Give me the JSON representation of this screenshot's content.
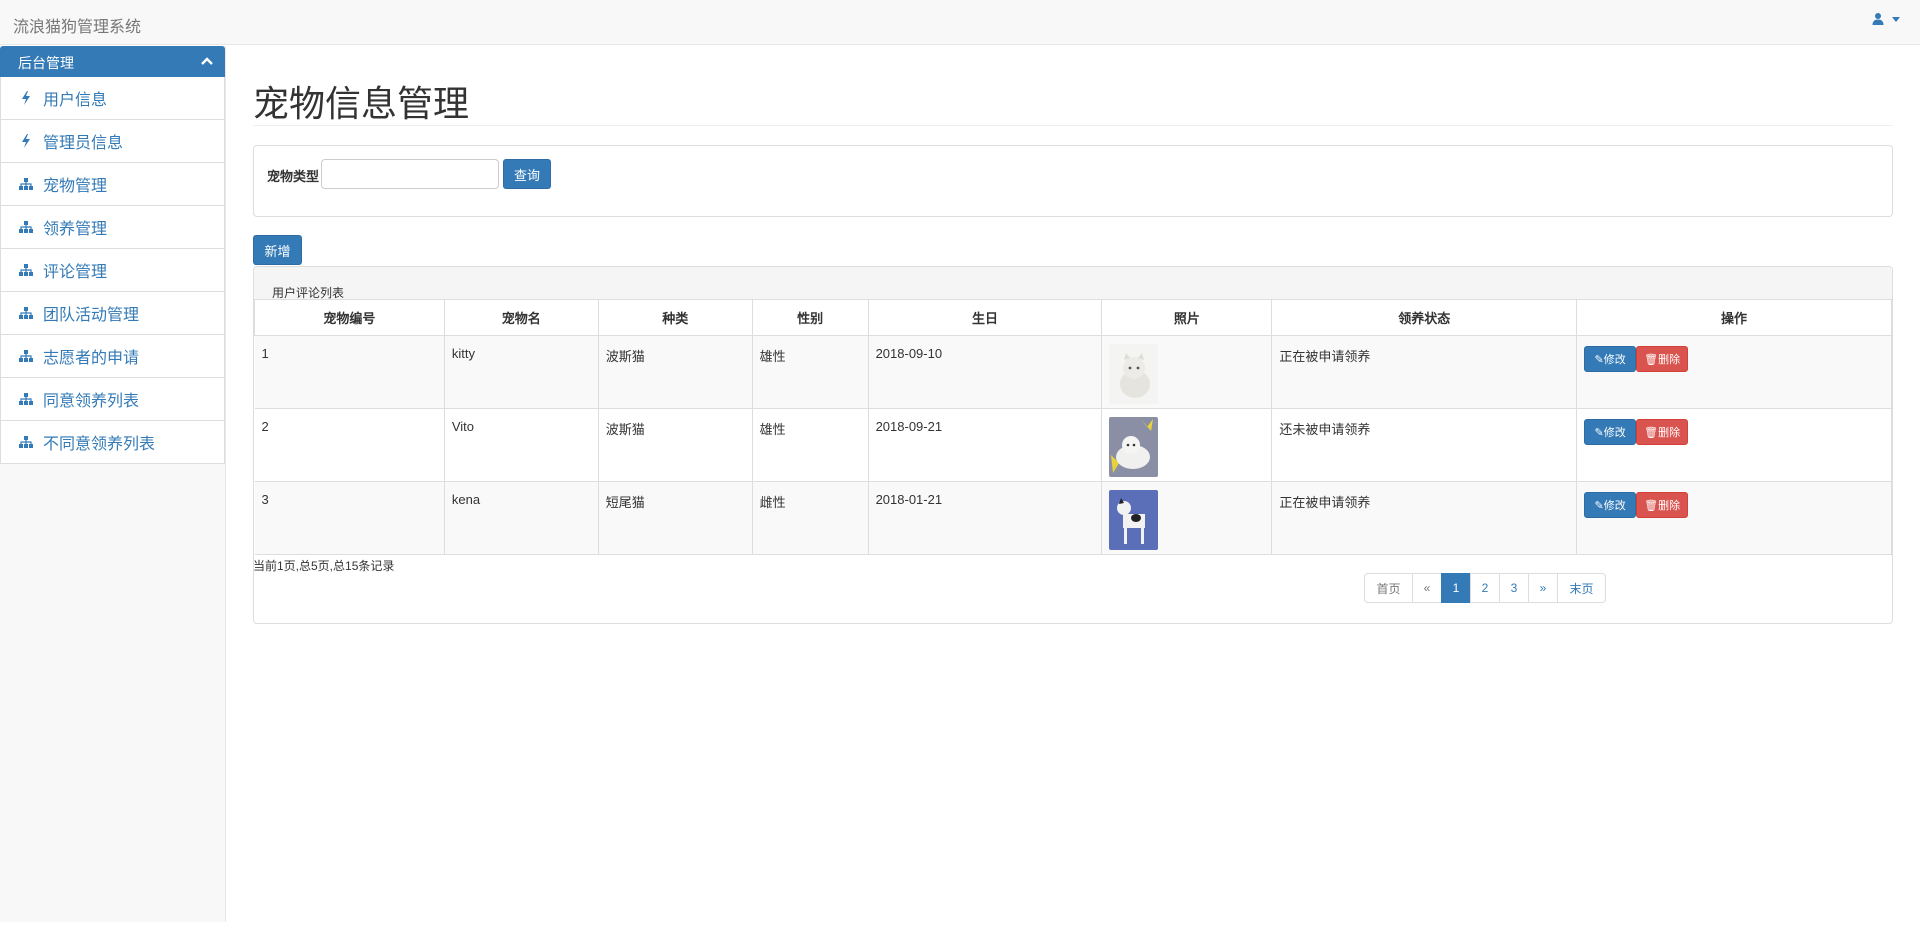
{
  "app": {
    "title": "流浪猫狗管理系统"
  },
  "sidebar": {
    "header": "后台管理",
    "items": [
      {
        "label": "用户信息",
        "icon": "bolt-icon"
      },
      {
        "label": "管理员信息",
        "icon": "bolt-icon"
      },
      {
        "label": "宠物管理",
        "icon": "sitemap-icon"
      },
      {
        "label": "领养管理",
        "icon": "sitemap-icon"
      },
      {
        "label": "评论管理",
        "icon": "sitemap-icon"
      },
      {
        "label": "团队活动管理",
        "icon": "sitemap-icon"
      },
      {
        "label": "志愿者的申请",
        "icon": "sitemap-icon"
      },
      {
        "label": "同意领养列表",
        "icon": "sitemap-icon"
      },
      {
        "label": "不同意领养列表",
        "icon": "sitemap-icon"
      }
    ]
  },
  "main": {
    "page_title": "宠物信息管理",
    "search": {
      "label": "宠物类型",
      "value": "",
      "button": "查询"
    },
    "add_button": "新增",
    "list_caption": "用户评论列表",
    "columns": [
      "宠物编号",
      "宠物名",
      "种类",
      "性别",
      "生日",
      "照片",
      "领养状态",
      "操作"
    ],
    "rows": [
      {
        "id": "1",
        "name": "kitty",
        "breed": "波斯猫",
        "sex": "雄性",
        "birthday": "2018-09-10",
        "status": "正在被申请领养"
      },
      {
        "id": "2",
        "name": "Vito",
        "breed": "波斯猫",
        "sex": "雄性",
        "birthday": "2018-09-21",
        "status": "还未被申请领养"
      },
      {
        "id": "3",
        "name": "kena",
        "breed": "短尾猫",
        "sex": "雌性",
        "birthday": "2018-01-21",
        "status": "正在被申请领养"
      }
    ],
    "row_actions": {
      "edit": "修改",
      "delete": "删除"
    },
    "record_info": "当前1页,总5页,总15条记录",
    "pagination": {
      "first": "首页",
      "prev": "«",
      "pages": [
        "1",
        "2",
        "3"
      ],
      "current": "1",
      "next": "»",
      "last": "末页"
    }
  },
  "colors": {
    "primary": "#337ab7",
    "danger": "#d9534f"
  }
}
